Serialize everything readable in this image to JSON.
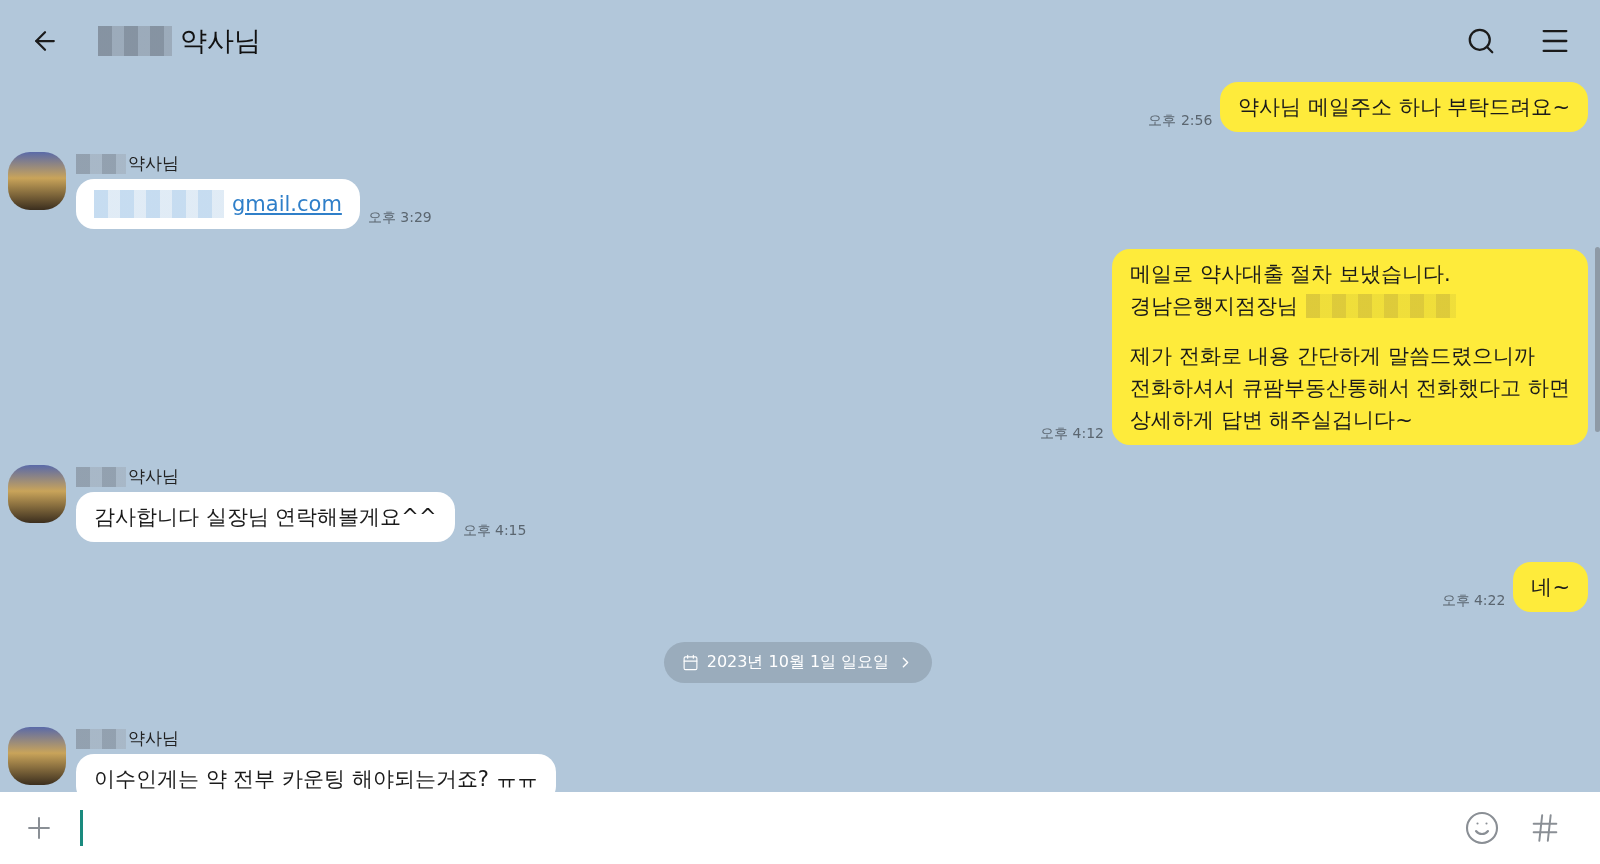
{
  "header": {
    "title": "약사님",
    "title_redacted": true
  },
  "messages": [
    {
      "kind": "sent",
      "time": "오후 2:56",
      "paragraphs": [
        [
          {
            "kind": "text",
            "text": "약사님 메일주소 하나 부탁드려요~"
          }
        ]
      ]
    },
    {
      "kind": "received",
      "sender": "약사님",
      "time": "오후 3:29",
      "paragraphs": [
        [
          {
            "kind": "link",
            "text": "gmail.com",
            "redacted_prefix": true
          }
        ]
      ]
    },
    {
      "kind": "sent",
      "time": "오후 4:12",
      "paragraphs": [
        [
          {
            "kind": "text",
            "text": "메일로 약사대출 절차 보냈습니다."
          },
          {
            "kind": "text",
            "text": "경남은행지점장님",
            "redacted_tail": true
          }
        ],
        [
          {
            "kind": "text",
            "text": "제가 전화로 내용 간단하게 말씀드렸으니까"
          },
          {
            "kind": "text",
            "text": "전화하셔서 큐팜부동산통해서 전화했다고 하면"
          },
          {
            "kind": "text",
            "text": "상세하게 답변 해주실겁니다~"
          }
        ]
      ]
    },
    {
      "kind": "received",
      "sender": "약사님",
      "time": "오후 4:15",
      "paragraphs": [
        [
          {
            "kind": "text",
            "text": "감사합니다 실장님 연락해볼게요^^"
          }
        ]
      ]
    },
    {
      "kind": "sent",
      "time": "오후 4:22",
      "paragraphs": [
        [
          {
            "kind": "text",
            "text": "네~"
          }
        ]
      ]
    },
    {
      "kind": "date",
      "text": "2023년 10월 1일 일요일"
    },
    {
      "kind": "received",
      "sender": "약사님",
      "paragraphs": [
        [
          {
            "kind": "text",
            "text": "이수인게는 약 전부 카운팅 해야되는거죠? ㅠㅠ"
          }
        ]
      ]
    }
  ]
}
